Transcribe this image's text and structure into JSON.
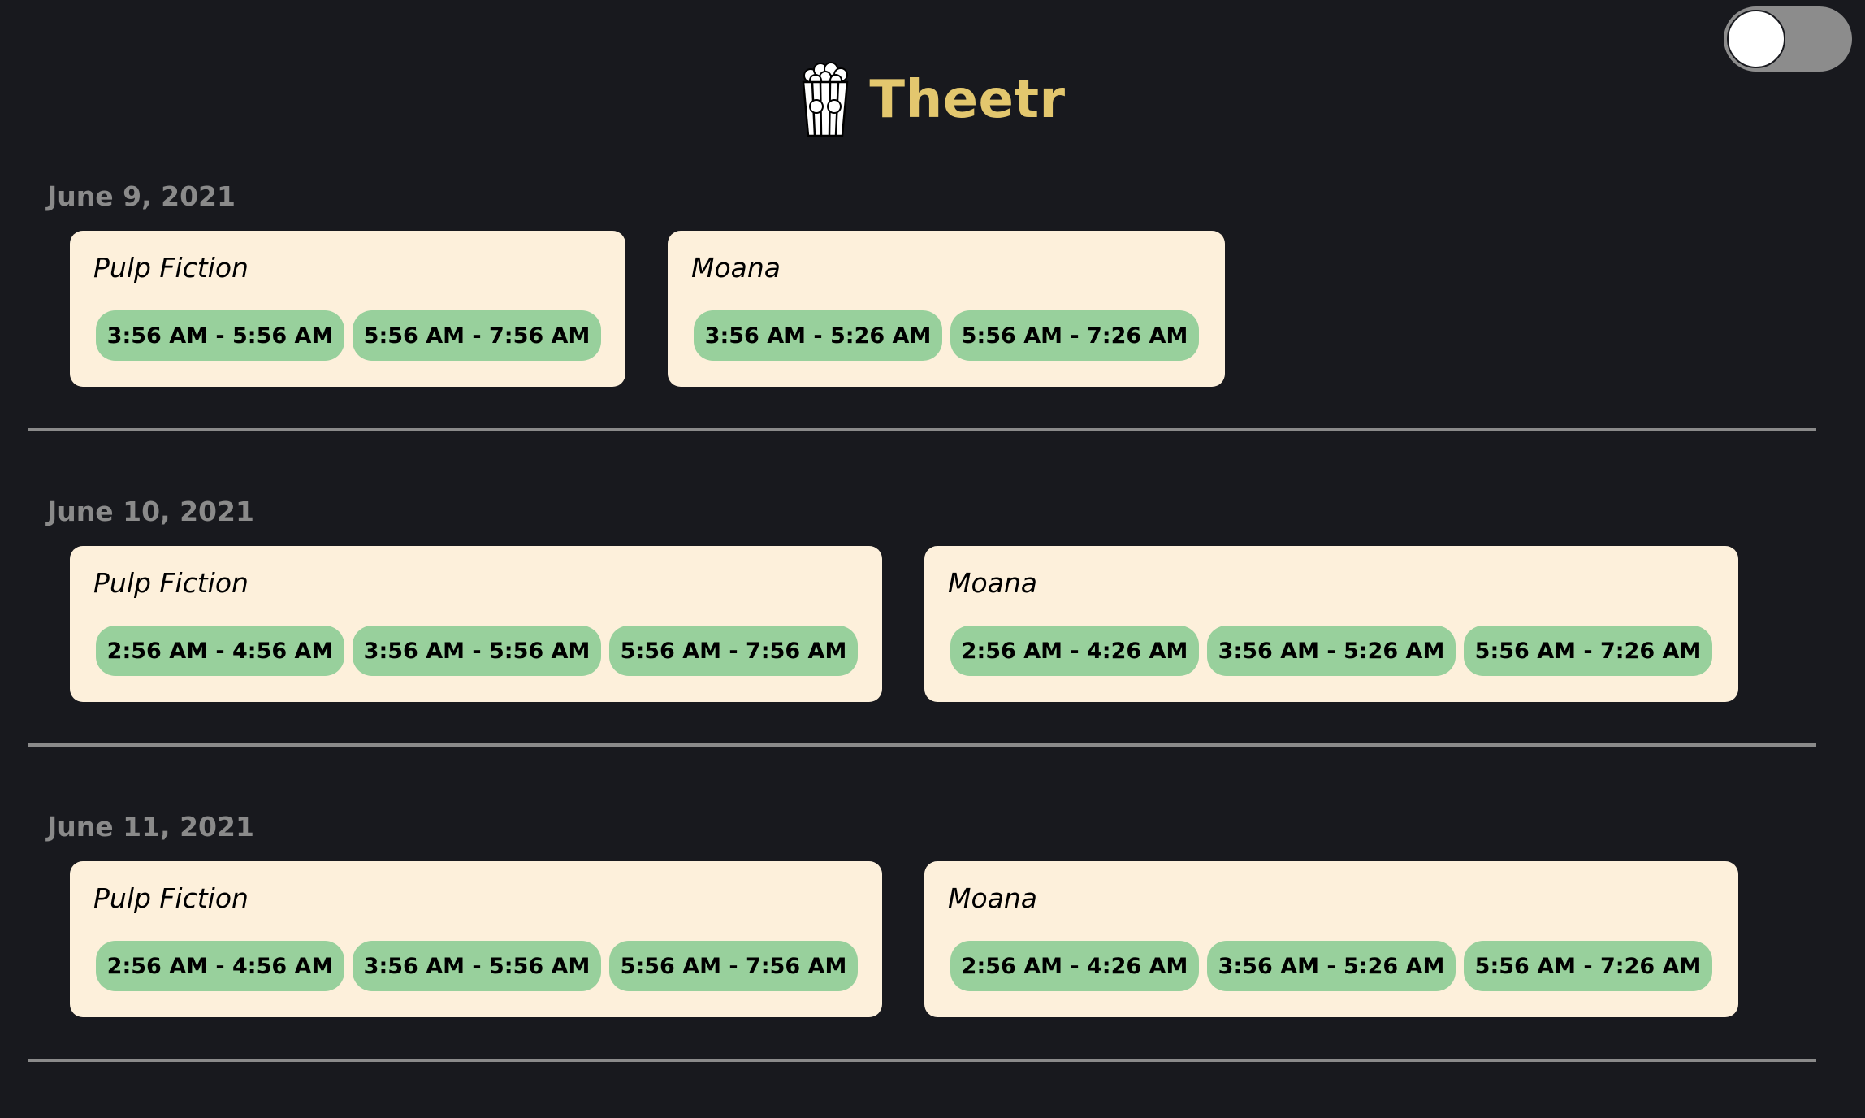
{
  "app": {
    "title": "Theetr",
    "logo_icon": "popcorn-icon",
    "accent_color": "#e3c76e"
  },
  "theme_toggle": {
    "state": "off"
  },
  "colors": {
    "background": "#18191e",
    "card": "#fdf0db",
    "time_pill": "#98d09c",
    "date_heading": "#8a8a8a"
  },
  "days": [
    {
      "date": "June 9, 2021",
      "movies": [
        {
          "title": "Pulp Fiction",
          "times": [
            "3:56 AM - 5:56 AM",
            "5:56 AM - 7:56 AM"
          ]
        },
        {
          "title": "Moana",
          "times": [
            "3:56 AM - 5:26 AM",
            "5:56 AM - 7:26 AM"
          ]
        }
      ]
    },
    {
      "date": "June 10, 2021",
      "movies": [
        {
          "title": "Pulp Fiction",
          "times": [
            "2:56 AM - 4:56 AM",
            "3:56 AM - 5:56 AM",
            "5:56 AM - 7:56 AM"
          ]
        },
        {
          "title": "Moana",
          "times": [
            "2:56 AM - 4:26 AM",
            "3:56 AM - 5:26 AM",
            "5:56 AM - 7:26 AM"
          ]
        }
      ]
    },
    {
      "date": "June 11, 2021",
      "movies": [
        {
          "title": "Pulp Fiction",
          "times": [
            "2:56 AM - 4:56 AM",
            "3:56 AM - 5:56 AM",
            "5:56 AM - 7:56 AM"
          ]
        },
        {
          "title": "Moana",
          "times": [
            "2:56 AM - 4:26 AM",
            "3:56 AM - 5:26 AM",
            "5:56 AM - 7:26 AM"
          ]
        }
      ]
    }
  ]
}
